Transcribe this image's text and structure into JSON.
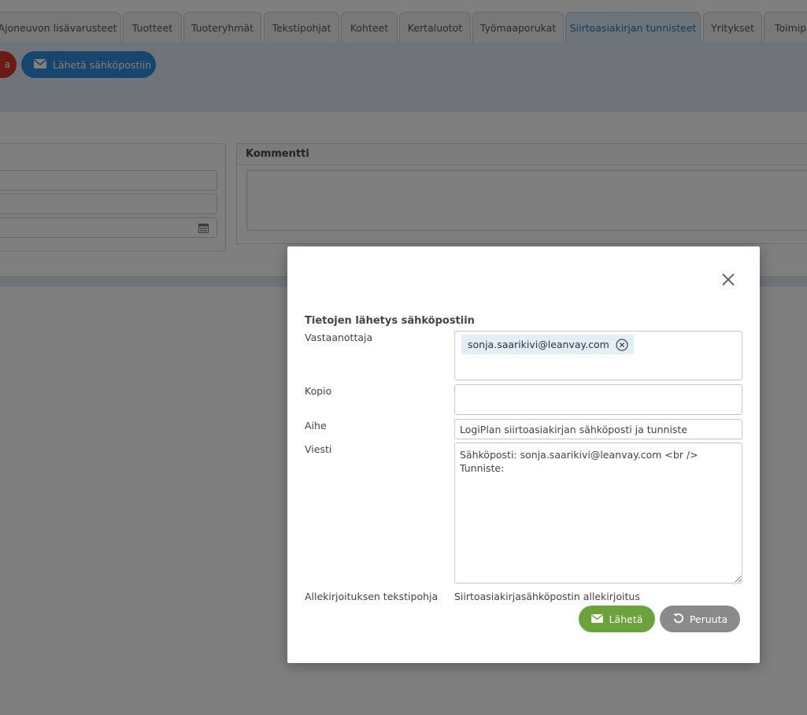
{
  "tabs": [
    {
      "label": "Ajoneuvon lisävarusteet",
      "active": false
    },
    {
      "label": "Tuotteet",
      "active": false
    },
    {
      "label": "Tuoteryhmät",
      "active": false
    },
    {
      "label": "Tekstipohjat",
      "active": false
    },
    {
      "label": "Kohteet",
      "active": false
    },
    {
      "label": "Kertaluotot",
      "active": false
    },
    {
      "label": "Työmaaporukat",
      "active": false
    },
    {
      "label": "Siirtoasiakirjan tunnisteet",
      "active": true
    },
    {
      "label": "Yritykset",
      "active": false
    },
    {
      "label": "Toimipi",
      "active": false
    }
  ],
  "toolbar": {
    "red_button_label": "a",
    "email_button_label": "Lähetä sähköpostiin"
  },
  "comment_panel": {
    "title": "Kommentti"
  },
  "modal": {
    "title": "Tietojen lähetys sähköpostiin",
    "recipient_label": "Vastaanottaja",
    "recipient_chip": "sonja.saarikivi@leanvay.com",
    "copy_label": "Kopio",
    "subject_label": "Aihe",
    "subject_value": "LogiPlan siirtoasiakirjan sähköposti ja tunniste",
    "message_label": "Viesti",
    "message_value": "Sähköposti: sonja.saarikivi@leanvay.com <br />\nTunniste:",
    "signature_label": "Allekirjoituksen tekstipohja",
    "signature_value": "Siirtoasiakirjasähköpostin allekirjoitus",
    "send_label": "Lähetä",
    "cancel_label": "Peruuta"
  },
  "colors": {
    "accent_blue": "#2f8ad6",
    "danger_red": "#d9342b",
    "send_green": "#6aa33b",
    "cancel_gray": "#8a8a8a",
    "active_tab_text": "#2a72b5"
  }
}
